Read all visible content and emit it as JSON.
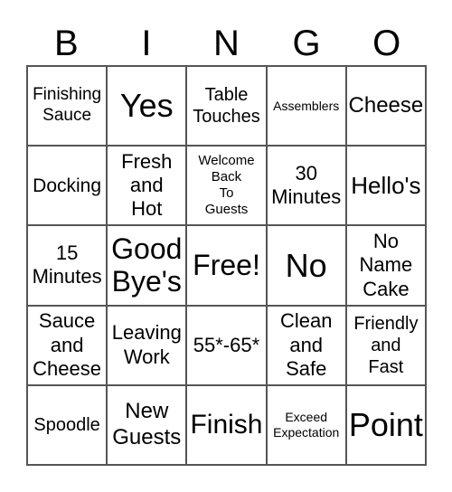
{
  "header": [
    "B",
    "I",
    "N",
    "G",
    "O"
  ],
  "cells": [
    "Finishing\nSauce",
    "Yes",
    "Table\nTouches",
    "Assemblers",
    "Cheese",
    "Docking",
    "Fresh\nand\nHot",
    "Welcome\nBack\nTo\nGuests",
    "30\nMinutes",
    "Hello's",
    "15\nMinutes",
    "Good\nBye's",
    "Free!",
    "No",
    "No\nName\nCake",
    "Sauce\nand\nCheese",
    "Leaving\nWork",
    "55*-65*",
    "Clean\nand\nSafe",
    "Friendly\nand\nFast",
    "Spoodle",
    "New\nGuests",
    "Finish",
    "Exceed\nExpectation",
    "Point"
  ]
}
